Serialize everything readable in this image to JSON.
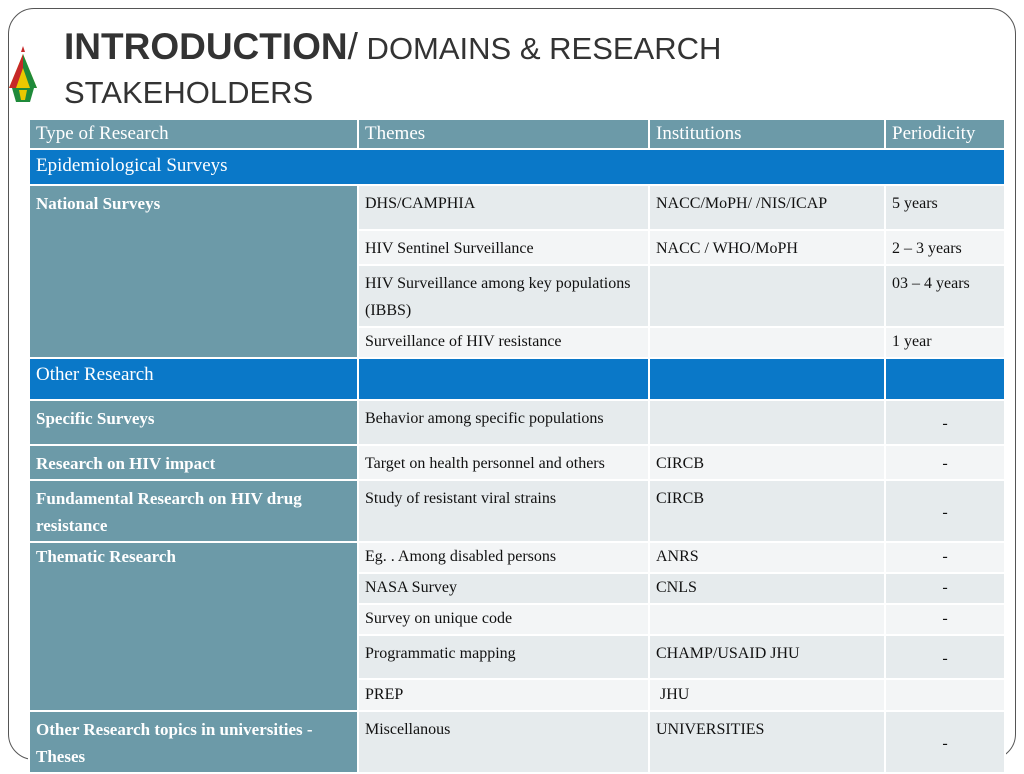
{
  "title": {
    "main": "INTRODUCTION",
    "slash": "/",
    "rest": " DOMAINS & RESEARCH",
    "line2": "STAKEHOLDERS"
  },
  "table": {
    "headers": [
      "Type of Research",
      "Themes",
      "Institutions",
      "Periodicity"
    ],
    "section1": "Epidemiological Surveys",
    "national_surveys": "National Surveys",
    "rows1": [
      {
        "theme": "DHS/CAMPHIA",
        "inst": "NACC/MoPH/ /NIS/ICAP",
        "period": "5 years"
      },
      {
        "theme": "HIV Sentinel Surveillance",
        "inst": "NACC / WHO/MoPH",
        "period": "2 – 3 years"
      },
      {
        "theme": "HIV Surveillance  among key populations (IBBS)",
        "inst": "",
        "period": "03 – 4 years"
      },
      {
        "theme": "Surveillance of HIV resistance",
        "inst": "",
        "period": "1 year"
      }
    ],
    "section2": "Other Research",
    "specific_surveys": {
      "type": "Specific Surveys",
      "theme": "Behavior among specific  populations",
      "inst": "",
      "period": "-"
    },
    "hiv_impact": {
      "type": "Research on HIV impact",
      "theme": "Target on health personnel and others",
      "inst": "CIRCB",
      "period": "-"
    },
    "fundamental": {
      "type": "Fundamental  Research on HIV  drug resistance",
      "theme": "Study of resistant viral strains",
      "inst": "CIRCB",
      "period": "-"
    },
    "thematic_label": "Thematic Research",
    "thematic_rows": [
      {
        "theme": "Eg. . Among  disabled persons",
        "inst": "ANRS",
        "period": "-"
      },
      {
        "theme": "NASA Survey",
        "inst": "CNLS",
        "period": "-"
      },
      {
        "theme": "Survey on unique code",
        "inst": "",
        "period": "-"
      },
      {
        "theme": "Programmatic mapping",
        "inst": "CHAMP/USAID JHU",
        "period": "-"
      },
      {
        "theme": "PREP",
        "inst": " JHU",
        "period": ""
      }
    ],
    "universities": {
      "type": "Other  Research topics  in universities - Theses",
      "theme": "Miscellanous",
      "inst": "UNIVERSITIES",
      "period": "-"
    }
  }
}
